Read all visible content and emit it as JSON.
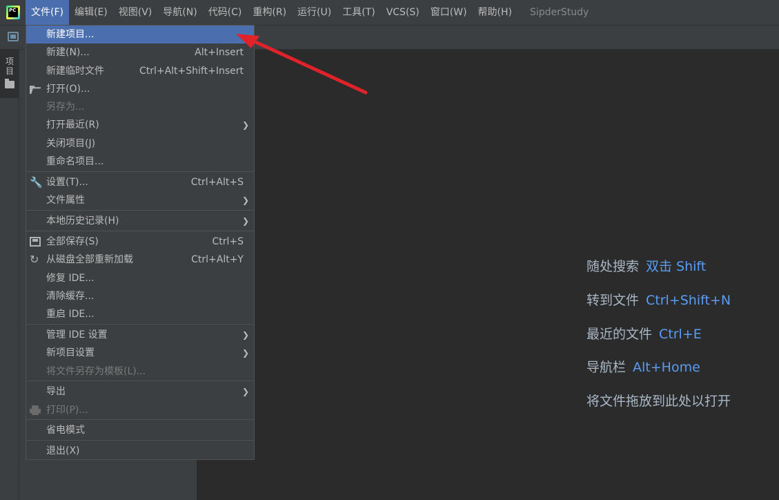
{
  "app": {
    "logo_text": "PC",
    "project_title": "SipderStudy"
  },
  "menubar": {
    "items": [
      {
        "label": "文件(F)"
      },
      {
        "label": "编辑(E)"
      },
      {
        "label": "视图(V)"
      },
      {
        "label": "导航(N)"
      },
      {
        "label": "代码(C)"
      },
      {
        "label": "重构(R)"
      },
      {
        "label": "运行(U)"
      },
      {
        "label": "工具(T)"
      },
      {
        "label": "VCS(S)"
      },
      {
        "label": "窗口(W)"
      },
      {
        "label": "帮助(H)"
      }
    ]
  },
  "side": {
    "project_tab_label": "项目"
  },
  "file_menu": {
    "items": [
      {
        "label": "新建项目...",
        "shortcut": ""
      },
      {
        "label": "新建(N)...",
        "shortcut": "Alt+Insert"
      },
      {
        "label": "新建临时文件",
        "shortcut": "Ctrl+Alt+Shift+Insert"
      },
      {
        "label": "打开(O)...",
        "shortcut": ""
      },
      {
        "label": "另存为...",
        "shortcut": ""
      },
      {
        "label": "打开最近(R)",
        "shortcut": ""
      },
      {
        "label": "关闭项目(J)",
        "shortcut": ""
      },
      {
        "label": "重命名项目...",
        "shortcut": ""
      },
      {
        "label": "设置(T)...",
        "shortcut": "Ctrl+Alt+S"
      },
      {
        "label": "文件属性",
        "shortcut": ""
      },
      {
        "label": "本地历史记录(H)",
        "shortcut": ""
      },
      {
        "label": "全部保存(S)",
        "shortcut": "Ctrl+S"
      },
      {
        "label": "从磁盘全部重新加载",
        "shortcut": "Ctrl+Alt+Y"
      },
      {
        "label": "修复 IDE...",
        "shortcut": ""
      },
      {
        "label": "清除缓存...",
        "shortcut": ""
      },
      {
        "label": "重启 IDE...",
        "shortcut": ""
      },
      {
        "label": "管理 IDE 设置",
        "shortcut": ""
      },
      {
        "label": "新项目设置",
        "shortcut": ""
      },
      {
        "label": "将文件另存为模板(L)...",
        "shortcut": ""
      },
      {
        "label": "导出",
        "shortcut": ""
      },
      {
        "label": "打印(P)...",
        "shortcut": ""
      },
      {
        "label": "省电模式",
        "shortcut": ""
      },
      {
        "label": "退出(X)",
        "shortcut": ""
      }
    ]
  },
  "editor_hints": [
    {
      "label": "随处搜索",
      "key": "双击 Shift"
    },
    {
      "label": "转到文件",
      "key": "Ctrl+Shift+N"
    },
    {
      "label": "最近的文件",
      "key": "Ctrl+E"
    },
    {
      "label": "导航栏",
      "key": "Alt+Home"
    },
    {
      "label": "将文件拖放到此处以打开",
      "key": ""
    }
  ],
  "colors": {
    "accent": "#4b6eaf",
    "annotation_arrow": "#e0232b",
    "hint_key": "#589df6"
  }
}
